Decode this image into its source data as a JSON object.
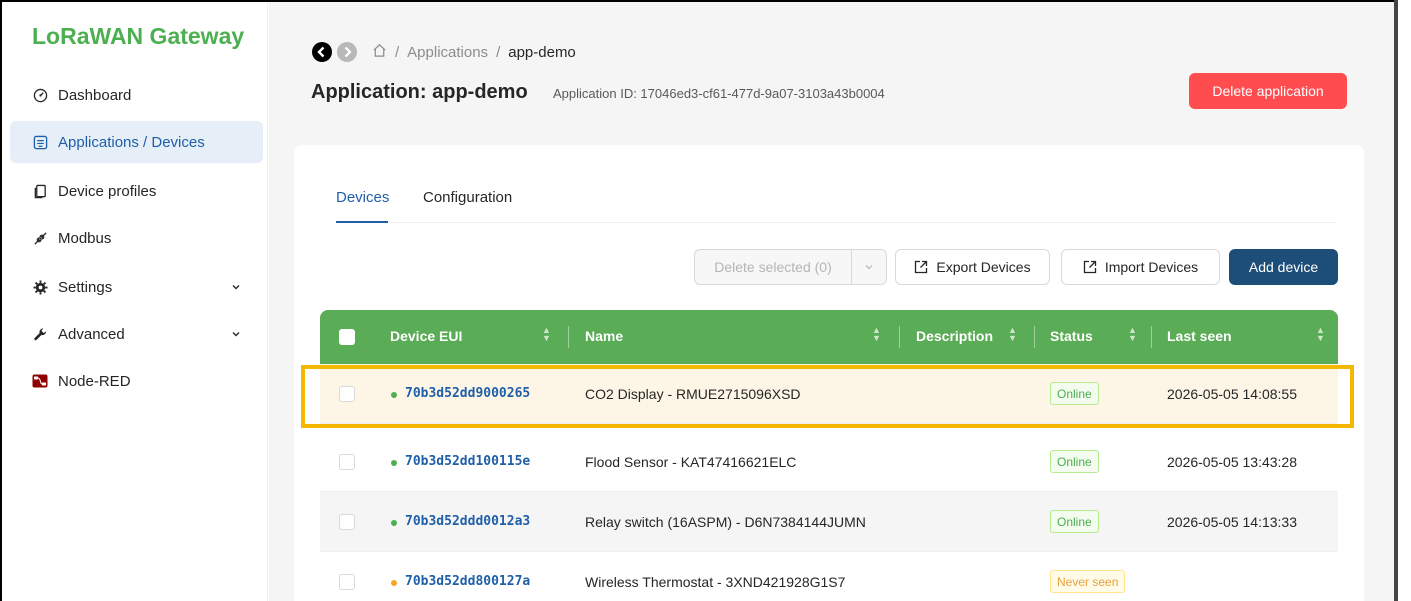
{
  "sidebar": {
    "brand": "LoRaWAN Gateway",
    "items": [
      {
        "label": "Dashboard",
        "icon": "dashboard-icon"
      },
      {
        "label": "Applications / Devices",
        "icon": "applications-icon",
        "active": true
      },
      {
        "label": "Device profiles",
        "icon": "device-profiles-icon"
      },
      {
        "label": "Modbus",
        "icon": "modbus-icon"
      },
      {
        "label": "Settings",
        "icon": "gear-icon",
        "expandable": true
      },
      {
        "label": "Advanced",
        "icon": "wrench-icon",
        "expandable": true
      },
      {
        "label": "Node-RED",
        "icon": "node-red-icon"
      }
    ]
  },
  "header": {
    "breadcrumb": {
      "home_icon": "home-icon",
      "separator": "/",
      "items": [
        "Applications",
        "app-demo"
      ]
    },
    "title": "Application: app-demo",
    "application_id": "Application ID: 17046ed3-cf61-477d-9a07-3103a43b0004",
    "delete_label": "Delete application"
  },
  "tabs": [
    {
      "label": "Devices",
      "active": true
    },
    {
      "label": "Configuration"
    }
  ],
  "toolbar": {
    "delete_selected": "Delete selected (0)",
    "export": "Export Devices",
    "import": "Import Devices",
    "add": "Add device"
  },
  "table": {
    "columns": [
      "Device EUI",
      "Name",
      "Description",
      "Status",
      "Last seen"
    ],
    "rows": [
      {
        "eui": "70b3d52dd9000265",
        "name": "CO2 Display - RMUE2715096XSD",
        "description": "",
        "status": "Online",
        "last_seen": "2026-05-05 14:08:55"
      },
      {
        "eui": "70b3d52dd100115e",
        "name": "Flood Sensor - KAT47416621ELC",
        "description": "",
        "status": "Online",
        "last_seen": "2026-05-05 13:43:28"
      },
      {
        "eui": "70b3d52ddd0012a3",
        "name": "Relay switch (16ASPM) - D6N7384144JUMN",
        "description": "",
        "status": "Online",
        "last_seen": "2026-05-05 14:13:33"
      },
      {
        "eui": "70b3d52dd800127a",
        "name": "Wireless Thermostat - 3XND421928G1S7",
        "description": "",
        "status": "Never seen",
        "last_seen": ""
      }
    ]
  },
  "colors": {
    "brand": "#4caf50",
    "header_green": "#5aac56",
    "primary": "#1d4e79",
    "danger": "#ff4d4f",
    "highlight": "#f5b800",
    "online": "#4caf50",
    "never_seen": "#e6a23c"
  }
}
